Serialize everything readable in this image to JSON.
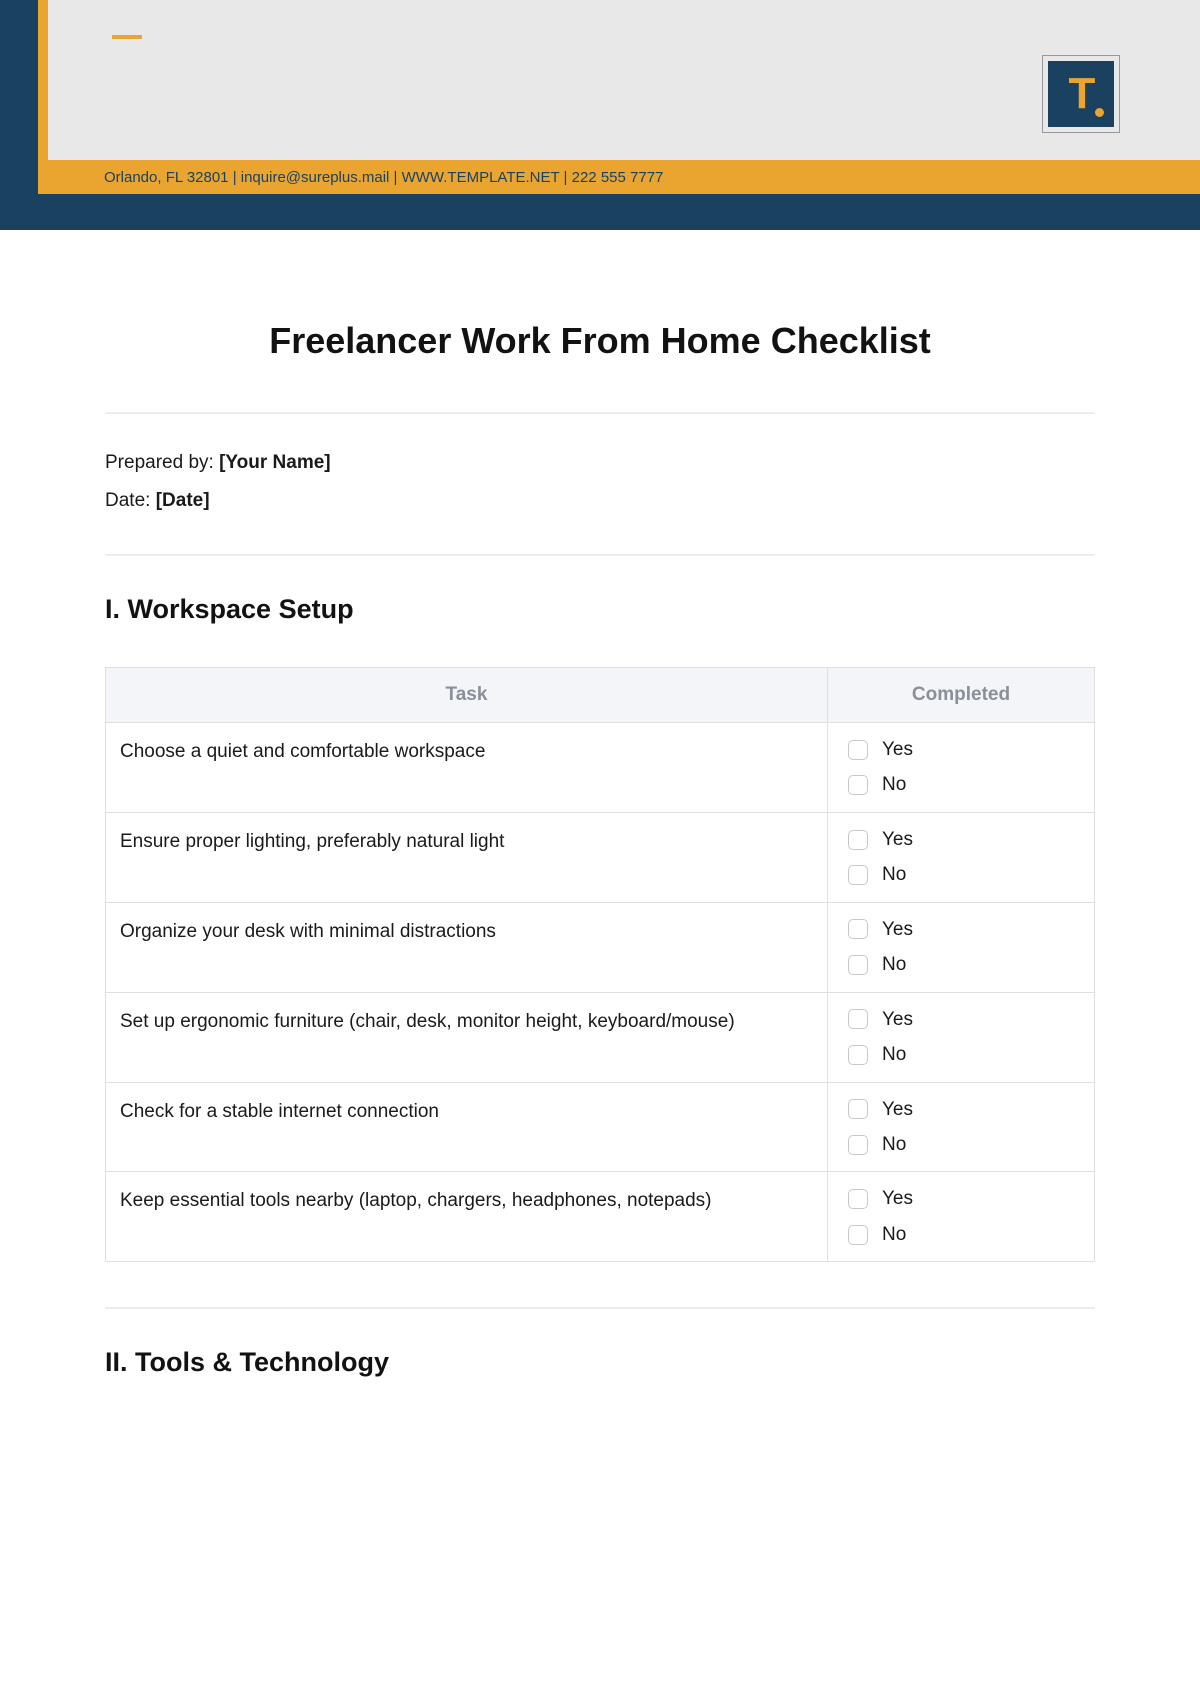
{
  "header": {
    "contact": "Orlando, FL 32801 | inquire@sureplus.mail | WWW.TEMPLATE.NET | 222 555 7777",
    "logo_letter": "T"
  },
  "title": "Freelancer Work From Home Checklist",
  "meta": {
    "prepared_label": "Prepared by: ",
    "prepared_value": "[Your Name]",
    "date_label": "Date: ",
    "date_value": "[Date]"
  },
  "table": {
    "headers": {
      "task": "Task",
      "completed": "Completed"
    },
    "options": {
      "yes": "Yes",
      "no": "No"
    }
  },
  "sections": [
    {
      "title": "I. Workspace Setup",
      "tasks": [
        "Choose a quiet and comfortable workspace",
        "Ensure proper lighting, preferably natural light",
        "Organize your desk with minimal distractions",
        "Set up ergonomic furniture (chair, desk, monitor height, keyboard/mouse)",
        "Check for a stable internet connection",
        "Keep essential tools nearby (laptop, chargers, headphones, notepads)"
      ]
    },
    {
      "title": "II. Tools & Technology"
    }
  ]
}
